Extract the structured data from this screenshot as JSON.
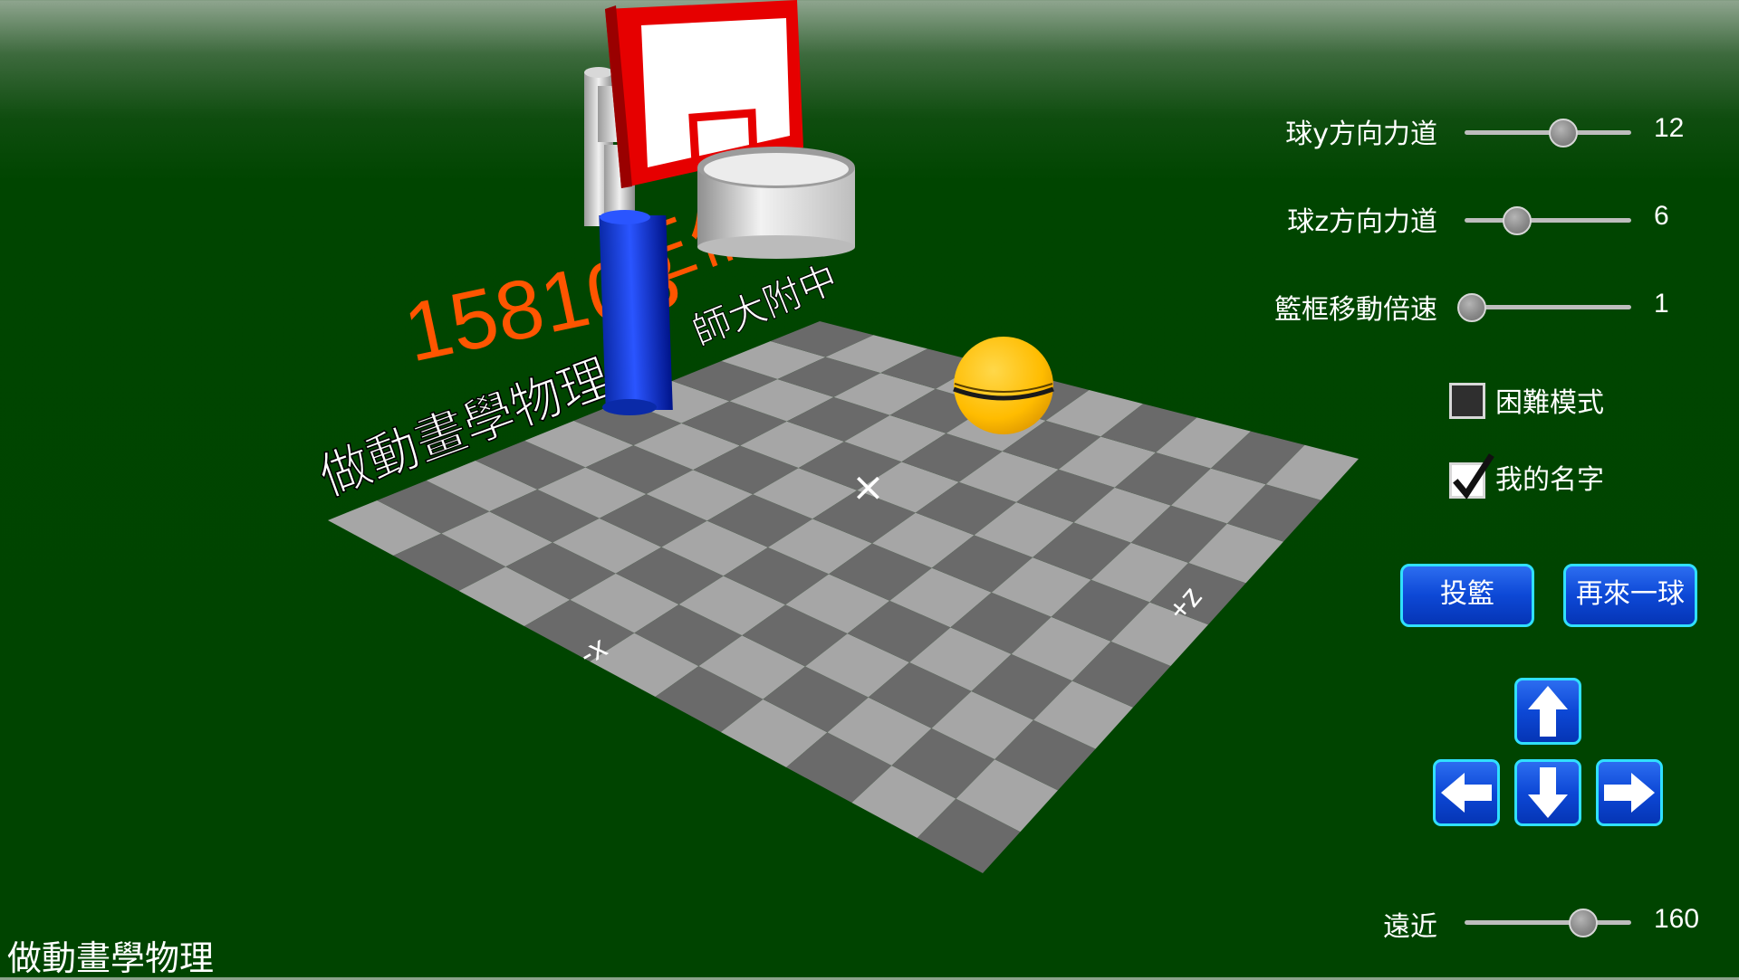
{
  "controls": {
    "ball_y_force": {
      "label": "球y方向力道",
      "value": "12",
      "min": 0,
      "max": 20,
      "current": 12
    },
    "ball_z_force": {
      "label": "球z方向力道",
      "value": "6",
      "min": 0,
      "max": 20,
      "current": 6
    },
    "hoop_speed": {
      "label": "籃框移動倍速",
      "value": "1",
      "min": 1,
      "max": 10,
      "current": 1
    },
    "distance": {
      "label": "遠近",
      "value": "160",
      "min": 50,
      "max": 200,
      "current": 160
    }
  },
  "checkboxes": {
    "hard_mode": {
      "label": "困難模式",
      "checked": false
    },
    "my_name": {
      "label": "我的名字",
      "checked": true
    }
  },
  "buttons": {
    "shoot": "投籃",
    "again": "再來一球"
  },
  "arrows": [
    "up-arrow-icon",
    "down-arrow-icon",
    "left-arrow-icon",
    "right-arrow-icon"
  ],
  "scene": {
    "banner_number": "158103",
    "banner_suffix": "王倍",
    "floor_caption": "做動畫學物理",
    "school": "師大附中",
    "axis_x_neg": "-x",
    "axis_z_pos": "+z",
    "center_mark": "×"
  },
  "footer": {
    "title": "做動畫學物理"
  },
  "colors": {
    "background": "#004400",
    "ball": "#ffbf00",
    "pole": "#0033cc",
    "backboard_frame": "#e60000",
    "banner_text": "#ff5500",
    "button": "#0d48d6",
    "button_border": "#30e0ff"
  }
}
